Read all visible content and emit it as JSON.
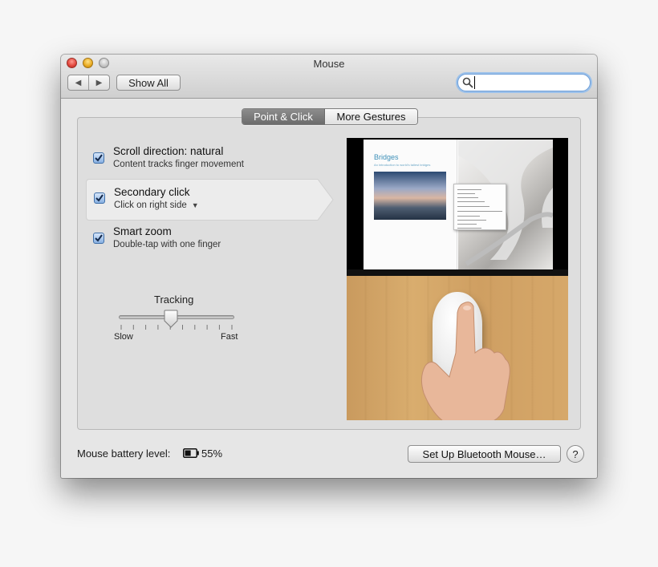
{
  "window": {
    "title": "Mouse",
    "show_all_label": "Show All",
    "back_icon": "back-arrow-icon",
    "forward_icon": "forward-arrow-icon",
    "search_placeholder": ""
  },
  "tabs": [
    {
      "label": "Point & Click",
      "active": true
    },
    {
      "label": "More Gestures",
      "active": false
    }
  ],
  "options": [
    {
      "title": "Scroll direction: natural",
      "subtitle": "Content tracks finger movement",
      "checked": true
    },
    {
      "title": "Secondary click",
      "subtitle": "Click on right side",
      "checked": true,
      "has_dropdown": true,
      "selected": true
    },
    {
      "title": "Smart zoom",
      "subtitle": "Double-tap with one finger",
      "checked": true
    }
  ],
  "tracking": {
    "label": "Tracking",
    "min_label": "Slow",
    "max_label": "Fast",
    "level": 0.45
  },
  "preview": {
    "book_title": "Bridges",
    "book_subtitle": "An introduction to world's tallest bridges"
  },
  "footer": {
    "battery_label": "Mouse battery level:",
    "battery_percent": "55%",
    "setup_button": "Set Up Bluetooth Mouse…",
    "help_button": "?"
  },
  "colors": {
    "accent_focus": "#6f9fd8",
    "tab_active_bg": "#7c7c7c"
  }
}
